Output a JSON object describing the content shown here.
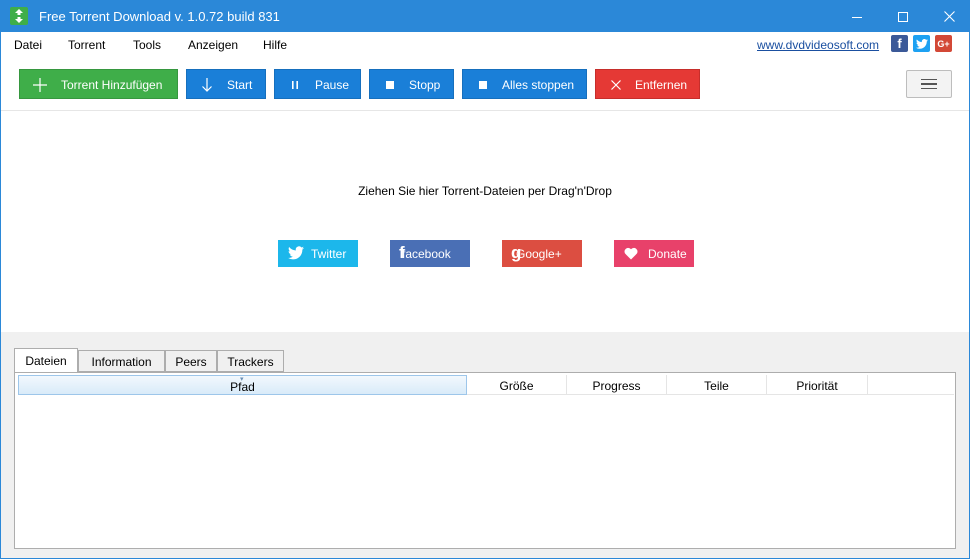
{
  "window": {
    "title": "Free Torrent Download v. 1.0.72 build 831",
    "accent_color": "#2b88d8"
  },
  "titlebar": {
    "app_icon": "download-arrows-icon",
    "minimize_icon": "minimize-icon",
    "maximize_icon": "maximize-icon",
    "close_icon": "close-icon"
  },
  "menu": {
    "items": [
      "Datei",
      "Torrent",
      "Tools",
      "Anzeigen",
      "Hilfe"
    ],
    "site_link": "www.dvdvideosoft.com",
    "social": {
      "facebook": "f",
      "twitter_icon": "twitter-bird-icon",
      "googleplus": "G+"
    }
  },
  "toolbar": {
    "add": "Torrent Hinzufügen",
    "start": "Start",
    "pause": "Pause",
    "stop": "Stopp",
    "stop_all": "Alles stoppen",
    "remove": "Entfernen",
    "colors": {
      "green": "#3fae49",
      "blue": "#1a7fd8",
      "red": "#e53935"
    }
  },
  "drop_area": {
    "hint": "Ziehen Sie hier Torrent-Dateien per Drag'n'Drop",
    "share": {
      "twitter": "Twitter",
      "facebook": "facebook",
      "facebook_glyph": "f",
      "googleplus": "Google+",
      "googleplus_glyph": "g",
      "donate": "Donate"
    }
  },
  "details": {
    "tabs": [
      "Dateien",
      "Information",
      "Peers",
      "Trackers"
    ],
    "active_tab": "Dateien",
    "columns": [
      "Pfad",
      "Größe",
      "Progress",
      "Teile",
      "Priorität"
    ],
    "sorted_column": "Pfad",
    "rows": []
  }
}
